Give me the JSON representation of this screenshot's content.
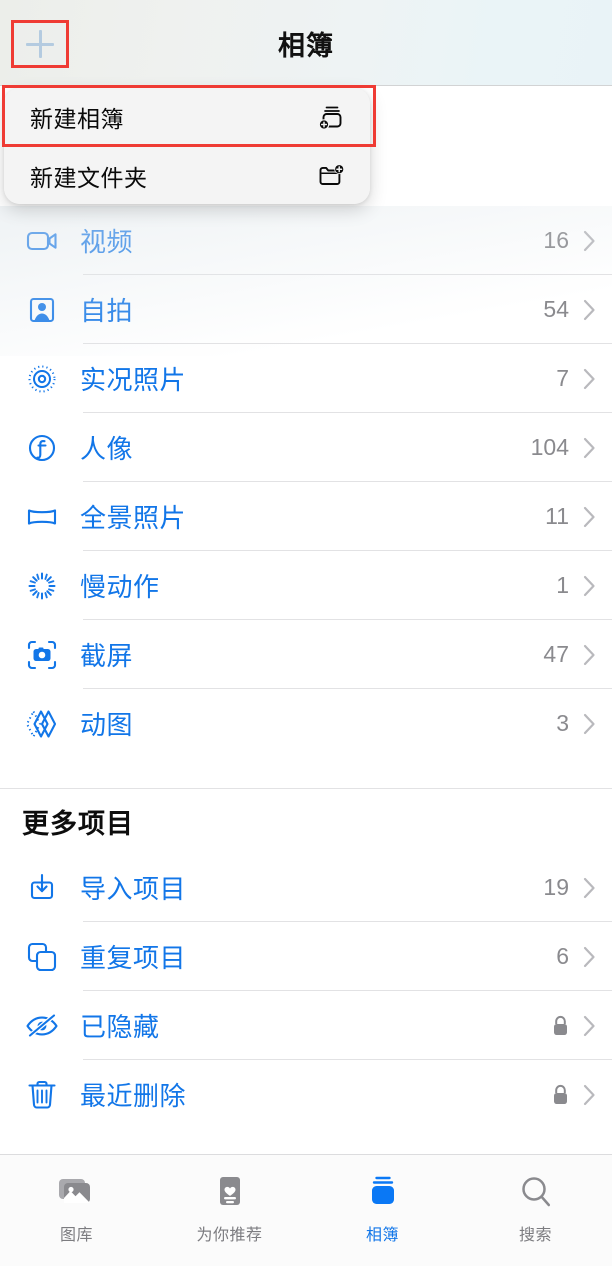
{
  "header": {
    "title": "相簿",
    "add_button_icon": "plus-icon",
    "accent_color": "#1276e8",
    "highlight_color": "#ef3b34"
  },
  "menu": {
    "items": [
      {
        "label": "新建相簿",
        "icon": "new-album-icon",
        "highlighted": true
      },
      {
        "label": "新建文件夹",
        "icon": "new-folder-icon",
        "highlighted": false
      }
    ]
  },
  "list": {
    "media_types": [
      {
        "label": "视频",
        "count": "16",
        "icon": "video-camera-icon"
      },
      {
        "label": "自拍",
        "count": "54",
        "icon": "selfie-person-icon"
      },
      {
        "label": "实况照片",
        "count": "7",
        "icon": "live-photo-icon"
      },
      {
        "label": "人像",
        "count": "104",
        "icon": "portrait-f-icon"
      },
      {
        "label": "全景照片",
        "count": "11",
        "icon": "panorama-icon"
      },
      {
        "label": "慢动作",
        "count": "1",
        "icon": "slow-motion-icon"
      },
      {
        "label": "截屏",
        "count": "47",
        "icon": "screenshot-camera-icon"
      },
      {
        "label": "动图",
        "count": "3",
        "icon": "animated-gif-icon"
      }
    ],
    "more_section_title": "更多项目",
    "more_items": [
      {
        "label": "导入项目",
        "count": "19",
        "icon": "import-download-icon",
        "locked": false
      },
      {
        "label": "重复项目",
        "count": "6",
        "icon": "duplicate-squares-icon",
        "locked": false
      },
      {
        "label": "已隐藏",
        "count": "",
        "icon": "eye-slash-icon",
        "locked": true
      },
      {
        "label": "最近删除",
        "count": "",
        "icon": "trash-icon",
        "locked": true
      }
    ]
  },
  "tabbar": {
    "tabs": [
      {
        "label": "图库",
        "icon": "photos-library-icon",
        "active": false
      },
      {
        "label": "为你推荐",
        "icon": "for-you-card-icon",
        "active": false
      },
      {
        "label": "相簿",
        "icon": "albums-stack-icon",
        "active": true
      },
      {
        "label": "搜索",
        "icon": "search-magnifier-icon",
        "active": false
      }
    ]
  }
}
